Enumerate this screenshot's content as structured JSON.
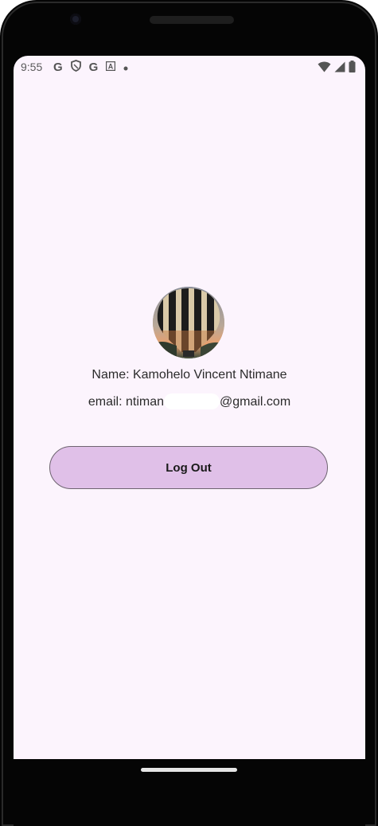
{
  "status_bar": {
    "time": "9:55",
    "left_icons": [
      "google-icon",
      "shield-icon",
      "google-icon",
      "font-icon",
      "dot-icon"
    ],
    "right_icons": [
      "wifi-icon",
      "signal-icon",
      "battery-icon"
    ],
    "g1": "G",
    "g2": "G",
    "font_glyph": "A"
  },
  "profile": {
    "name_line": "Name: Kamohelo Vincent Ntimane",
    "email_prefix": "email: ntiman",
    "email_suffix": "@gmail.com"
  },
  "actions": {
    "logout_label": "Log Out"
  },
  "colors": {
    "screen_bg": "#fcf4fd",
    "button_bg": "#e0c0e8",
    "button_border": "#6e6470"
  }
}
